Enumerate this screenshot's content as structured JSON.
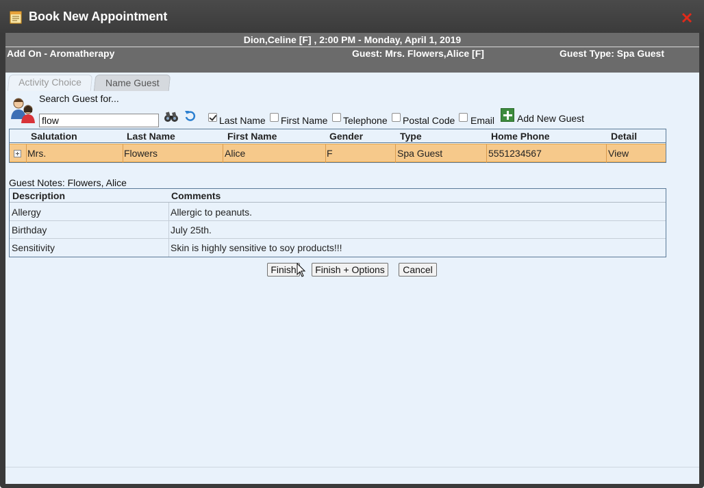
{
  "window": {
    "title": "Book New Appointment"
  },
  "info": {
    "appointment": "Dion,Celine [F] , 2:00 PM - Monday, April 1, 2019",
    "addon": "Add On - Aromatherapy",
    "guest": "Guest: Mrs. Flowers,Alice [F]",
    "guest_type": "Guest Type: Spa Guest"
  },
  "tabs": [
    {
      "label": "Activity Choice"
    },
    {
      "label": "Name Guest"
    }
  ],
  "search": {
    "label": "Search Guest for...",
    "value": "flow",
    "filters": [
      {
        "label": "Last Name",
        "checked": true
      },
      {
        "label": "First Name",
        "checked": false
      },
      {
        "label": "Telephone",
        "checked": false
      },
      {
        "label": "Postal Code",
        "checked": false
      },
      {
        "label": "Email",
        "checked": false
      }
    ],
    "add_new_label": "Add New Guest"
  },
  "results": {
    "columns": [
      "Salutation",
      "Last Name",
      "First Name",
      "Gender",
      "Type",
      "Home Phone",
      "Detail"
    ],
    "rows": [
      {
        "salutation": "Mrs.",
        "last_name": "Flowers",
        "first_name": "Alice",
        "gender": "F",
        "type": "Spa Guest",
        "home_phone": "5551234567",
        "detail": "View"
      }
    ]
  },
  "notes": {
    "title": "Guest Notes: Flowers, Alice",
    "columns": [
      "Description",
      "Comments"
    ],
    "rows": [
      {
        "description": "Allergy",
        "comment": "Allergic to peanuts."
      },
      {
        "description": "Birthday",
        "comment": "July 25th."
      },
      {
        "description": "Sensitivity",
        "comment": "Skin is highly sensitive to soy products!!!"
      }
    ]
  },
  "buttons": {
    "finish": "Finish",
    "finish_options": "Finish + Options",
    "cancel": "Cancel"
  },
  "colors": {
    "titlebar": "#3b3b3b",
    "infobar": "#6b6b6b",
    "content_bg": "#e9f2fb",
    "selected_row": "#f6c98b",
    "close_icon": "#e02a1a"
  }
}
